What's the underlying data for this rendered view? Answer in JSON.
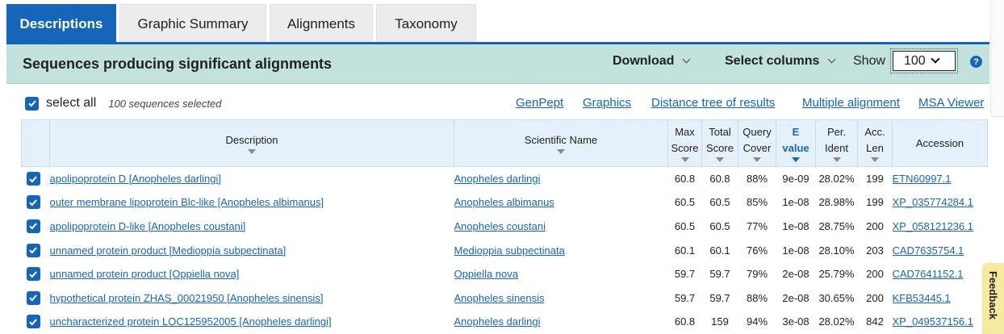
{
  "tabs": [
    "Descriptions",
    "Graphic Summary",
    "Alignments",
    "Taxonomy"
  ],
  "header": {
    "title": "Sequences producing significant alignments",
    "download": "Download",
    "select_columns": "Select columns",
    "show_label": "Show",
    "show_value": "100",
    "help": "?"
  },
  "selection": {
    "select_all": "select all",
    "count": "100 sequences selected"
  },
  "links": [
    "GenPept",
    "Graphics",
    "Distance tree of results",
    "Multiple alignment",
    "MSA Viewer"
  ],
  "table": {
    "headers": {
      "description": "Description",
      "scientific_name": "Scientific Name",
      "max_score": [
        "Max",
        "Score"
      ],
      "total_score": [
        "Total",
        "Score"
      ],
      "query_cover": [
        "Query",
        "Cover"
      ],
      "e_value": [
        "E",
        "value"
      ],
      "per_ident": [
        "Per.",
        "Ident"
      ],
      "acc_len": [
        "Acc.",
        "Len"
      ],
      "accession": "Accession"
    },
    "rows": [
      {
        "description": "apolipoprotein D [Anopheles darlingi]",
        "scientific_name": "Anopheles darlingi",
        "max_score": "60.8",
        "total_score": "60.8",
        "query_cover": "88%",
        "e_value": "9e-09",
        "per_ident": "28.02%",
        "acc_len": "199",
        "accession": "ETN60997.1"
      },
      {
        "description": "outer membrane lipoprotein Blc-like [Anopheles albimanus]",
        "scientific_name": "Anopheles albimanus",
        "max_score": "60.5",
        "total_score": "60.5",
        "query_cover": "85%",
        "e_value": "1e-08",
        "per_ident": "28.98%",
        "acc_len": "199",
        "accession": "XP_035774284.1"
      },
      {
        "description": "apolipoprotein D-like [Anopheles coustani]",
        "scientific_name": "Anopheles coustani",
        "max_score": "60.5",
        "total_score": "60.5",
        "query_cover": "77%",
        "e_value": "1e-08",
        "per_ident": "28.75%",
        "acc_len": "200",
        "accession": "XP_058121236.1"
      },
      {
        "description": "unnamed protein product [Medioppia subpectinata]",
        "scientific_name": "Medioppia subpectinata",
        "max_score": "60.1",
        "total_score": "60.1",
        "query_cover": "76%",
        "e_value": "1e-08",
        "per_ident": "28.10%",
        "acc_len": "203",
        "accession": "CAD7635754.1"
      },
      {
        "description": "unnamed protein product [Oppiella nova]",
        "scientific_name": "Oppiella nova",
        "max_score": "59.7",
        "total_score": "59.7",
        "query_cover": "79%",
        "e_value": "2e-08",
        "per_ident": "25.79%",
        "acc_len": "200",
        "accession": "CAD7641152.1"
      },
      {
        "description": "hypothetical protein ZHAS_00021950 [Anopheles sinensis]",
        "scientific_name": "Anopheles sinensis",
        "max_score": "59.7",
        "total_score": "59.7",
        "query_cover": "88%",
        "e_value": "2e-08",
        "per_ident": "30.65%",
        "acc_len": "200",
        "accession": "KFB53445.1"
      },
      {
        "description": "uncharacterized protein LOC125952005 [Anopheles darlingi]",
        "scientific_name": "Anopheles darlingi",
        "max_score": "60.8",
        "total_score": "159",
        "query_cover": "94%",
        "e_value": "3e-08",
        "per_ident": "28.02%",
        "acc_len": "842",
        "accession": "XP_049537156.1"
      }
    ]
  },
  "feedback": "Feedback"
}
